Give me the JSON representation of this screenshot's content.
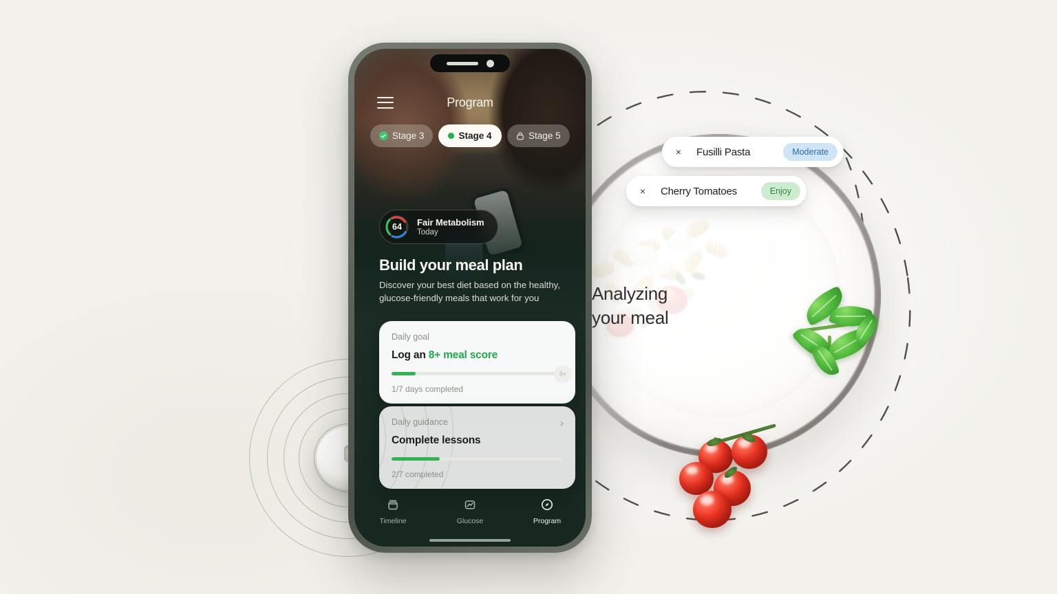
{
  "scene": {
    "background_color": "#f2f1ec",
    "analyzing_text_line1": "Analyzing",
    "analyzing_text_line2": "your meal",
    "objects": {
      "plate": "plate-with-pasta",
      "basil": "basil-sprig",
      "tomatoes": "cherry-tomato-vine",
      "sensor": "cgm-sensor-puck"
    }
  },
  "chips": [
    {
      "close_label": "×",
      "name": "Fusilli Pasta",
      "badge": "Moderate",
      "badge_bg": "#cfe4f7",
      "badge_color": "#2a6ea8"
    },
    {
      "close_label": "×",
      "name": "Cherry Tomatoes",
      "badge": "Enjoy",
      "badge_bg": "#cdeccf",
      "badge_color": "#2e8447"
    }
  ],
  "phone": {
    "frame_color": "#5d6359",
    "screen_bg": "#17271f",
    "topbar": {
      "menu_icon": "hamburger-icon",
      "title": "Program"
    },
    "stages": [
      {
        "label": "Stage 3",
        "state": "completed",
        "icon": "check-circle-icon"
      },
      {
        "label": "Stage 4",
        "state": "active",
        "icon": "green-dot-icon"
      },
      {
        "label": "Stage 5",
        "state": "locked",
        "icon": "lock-icon"
      }
    ],
    "metabolism": {
      "score": "64",
      "title": "Fair Metabolism",
      "subtitle": "Today",
      "gauge_colors": {
        "green": "#35c15f",
        "red": "#e0483b",
        "blue": "#3d7fd6",
        "track": "#3b3e3a"
      }
    },
    "headline": "Build your meal plan",
    "subhead": "Discover your best diet based on the healthy, glucose-friendly meals that work for you",
    "cards": [
      {
        "label": "Daily goal",
        "title_prefix": "Log an ",
        "title_highlight": "8+ meal score",
        "progress_percent": 14,
        "end_badge": "8+",
        "footer": "1/7 days completed",
        "chevron": ""
      },
      {
        "label": "Daily guidance",
        "title_prefix": "Complete lessons",
        "title_highlight": "",
        "progress_percent": 28,
        "end_badge": "",
        "footer": "2/7 completed",
        "chevron": "›"
      }
    ],
    "tabs": [
      {
        "label": "Timeline",
        "icon": "timeline-icon",
        "active": false
      },
      {
        "label": "Glucose",
        "icon": "glucose-chart-icon",
        "active": false
      },
      {
        "label": "Program",
        "icon": "program-compass-icon",
        "active": true
      }
    ],
    "accent_green": "#32b254"
  }
}
